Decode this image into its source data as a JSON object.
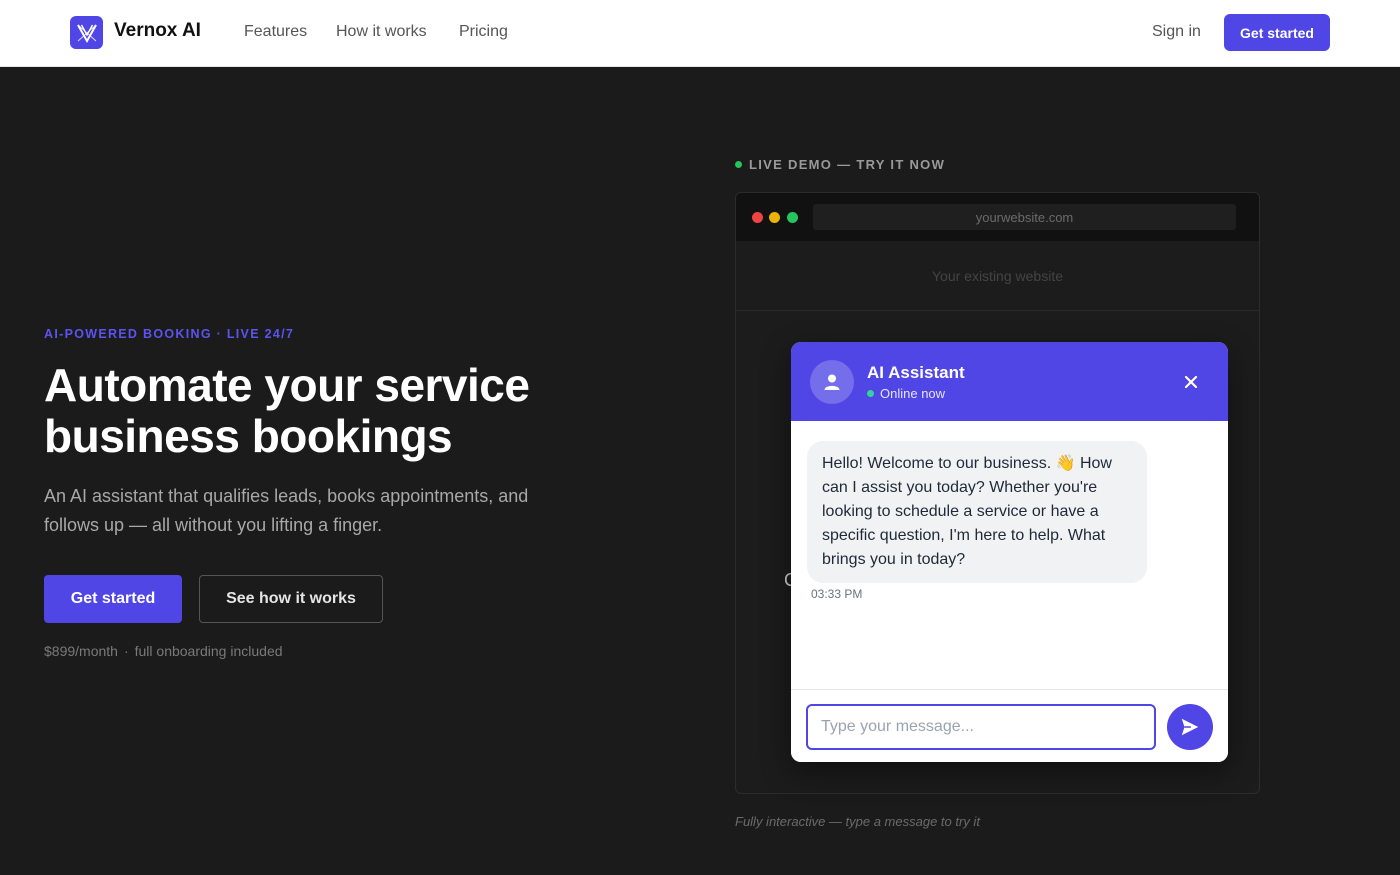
{
  "brand": {
    "name": "Vernox AI",
    "logo_icon": "vernox-logo-icon",
    "accent": "#4f46e5"
  },
  "nav": {
    "links": [
      "Features",
      "How it works",
      "Pricing"
    ],
    "signin": "Sign in",
    "cta": "Get started"
  },
  "hero": {
    "eyebrow": "AI-POWERED BOOKING · LIVE 24/7",
    "headline": "Automate your service business bookings",
    "subtitle": "An AI assistant that qualifies leads, books appointments, and follows up — all without you lifting a finger.",
    "primary_cta": "Get started",
    "secondary_cta": "See how it works",
    "price": "$899/month",
    "price_separator": "·",
    "price_note": "full onboarding included"
  },
  "demo": {
    "label": "LIVE DEMO — TRY IT NOW",
    "url": "yourwebsite.com",
    "existing_site": "Your existing website",
    "stray_char": "C",
    "caption": "Fully interactive — type a message to try it",
    "traffic_lights": [
      "#ef4444",
      "#eab308",
      "#22c55e"
    ]
  },
  "chat": {
    "title": "AI Assistant",
    "status": "Online now",
    "message": "Hello! Welcome to our business. 👋 How can I assist you today? Whether you're looking to schedule a service or have a specific question, I'm here to help. What brings you in today?",
    "time": "03:33 PM",
    "input_placeholder": "Type your message..."
  }
}
